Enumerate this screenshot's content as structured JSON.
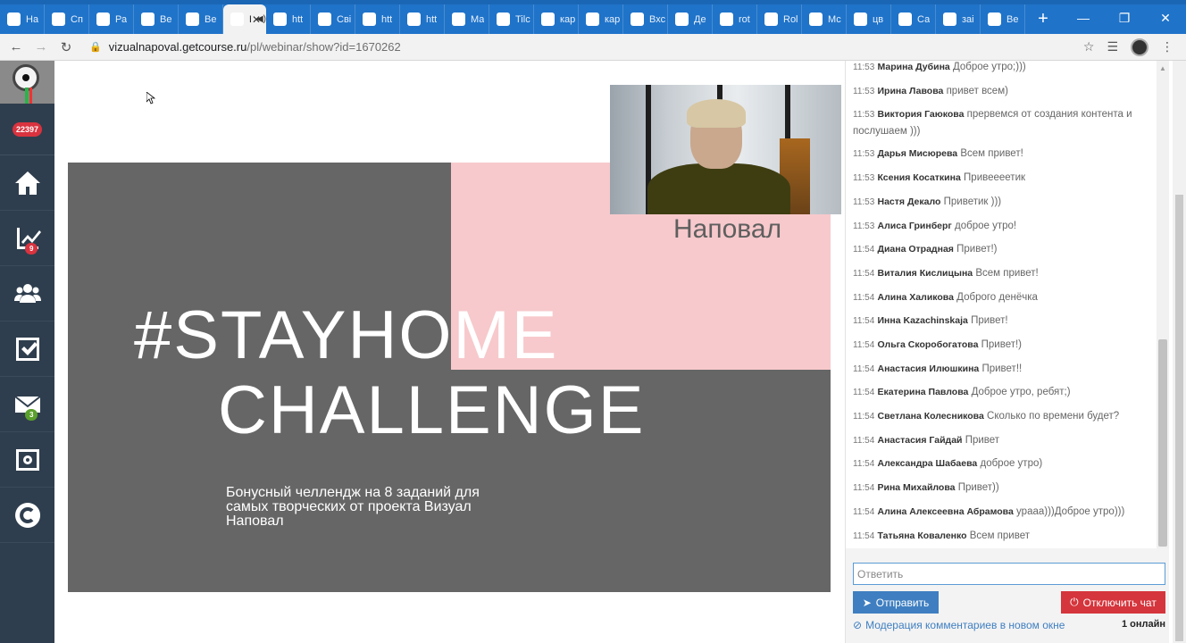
{
  "browser": {
    "tabs": [
      {
        "label": "На",
        "icon": "doc"
      },
      {
        "label": "Сп",
        "icon": "red-dot"
      },
      {
        "label": "Ра",
        "icon": "globe"
      },
      {
        "label": "Ве",
        "icon": "globe"
      },
      {
        "label": "Ве",
        "icon": "globe"
      },
      {
        "label": "В",
        "icon": "active",
        "active": true
      },
      {
        "label": "htt",
        "icon": "swirl"
      },
      {
        "label": "Сві",
        "icon": "bar"
      },
      {
        "label": "htt",
        "icon": "bar"
      },
      {
        "label": "htt",
        "icon": "bar"
      },
      {
        "label": "Ма",
        "icon": "bar"
      },
      {
        "label": "Tilc",
        "icon": "T"
      },
      {
        "label": "кар",
        "icon": "drive"
      },
      {
        "label": "кар",
        "icon": "drive"
      },
      {
        "label": "Вхс",
        "icon": "mail"
      },
      {
        "label": "Де",
        "icon": "arc"
      },
      {
        "label": "rot",
        "icon": "Я"
      },
      {
        "label": "Rol",
        "icon": "F"
      },
      {
        "label": "Мс",
        "icon": "drive"
      },
      {
        "label": "цв",
        "icon": "Я"
      },
      {
        "label": "Са",
        "icon": "pink"
      },
      {
        "label": "заі",
        "icon": "Я"
      },
      {
        "label": "Ве",
        "icon": "GC"
      }
    ],
    "new_tab": "+",
    "url_host": "vizualnapoval.getcourse.ru",
    "url_path": "/pl/webinar/show?id=1670262"
  },
  "sidebar": {
    "counter": "22397",
    "items": [
      {
        "name": "home",
        "badge": ""
      },
      {
        "name": "stats",
        "badge": "9",
        "badge_color": "red"
      },
      {
        "name": "users",
        "badge": ""
      },
      {
        "name": "tasks",
        "badge": ""
      },
      {
        "name": "messages",
        "badge": "3",
        "badge_color": "green"
      },
      {
        "name": "safe",
        "badge": ""
      },
      {
        "name": "getcourse",
        "badge": ""
      }
    ]
  },
  "slide": {
    "brand": "Наповал",
    "line1": "#STAYHOME",
    "line2": "CHALLENGE",
    "subtitle": "Бонусный челлендж на 8 заданий  для самых творческих от проекта Визуал Наповал"
  },
  "chat": {
    "messages": [
      {
        "time": "11:53",
        "name": "Марина Дубина",
        "text": "Доброе утро;)))"
      },
      {
        "time": "11:53",
        "name": "Ирина Лавова",
        "text": "привет всем)"
      },
      {
        "time": "11:53",
        "name": "Виктория Гаюкова",
        "text": "прервемся от создания контента и послушаем )))"
      },
      {
        "time": "11:53",
        "name": "Дарья Мисюрева",
        "text": "Всем привет!"
      },
      {
        "time": "11:53",
        "name": "Ксения Косаткина",
        "text": "Привееeетик"
      },
      {
        "time": "11:53",
        "name": "Настя Декало",
        "text": "Приветик )))"
      },
      {
        "time": "11:53",
        "name": "Алиса Гринберг",
        "text": "доброе утро!"
      },
      {
        "time": "11:54",
        "name": "Диана Отрадная",
        "text": "Привет!)"
      },
      {
        "time": "11:54",
        "name": "Виталия Кислицына",
        "text": "Всем привет!"
      },
      {
        "time": "11:54",
        "name": "Алина Халикова",
        "text": "Доброго денёчка"
      },
      {
        "time": "11:54",
        "name": "Инна Kazachinskaja",
        "text": "Привет!"
      },
      {
        "time": "11:54",
        "name": "Ольга Скоробогатова",
        "text": "Привет!)"
      },
      {
        "time": "11:54",
        "name": "Анастасия Илюшкина",
        "text": "Привет!!"
      },
      {
        "time": "11:54",
        "name": "Екатерина Павлова",
        "text": "Доброе утро, ребят;)"
      },
      {
        "time": "11:54",
        "name": "Светлана Колесникова",
        "text": "Сколько по времени будет?"
      },
      {
        "time": "11:54",
        "name": "Анастасия Гайдай",
        "text": "Привет"
      },
      {
        "time": "11:54",
        "name": "Александра Шабаева",
        "text": "доброе утро)"
      },
      {
        "time": "11:54",
        "name": "Рина Михайлова",
        "text": "Привет))"
      },
      {
        "time": "11:54",
        "name": "Алина Алексеевна Абрамова",
        "text": "урааа)))Доброе утро)))"
      },
      {
        "time": "11:54",
        "name": "Татьяна Коваленко",
        "text": "Всем привет"
      }
    ],
    "reply_placeholder": "Ответить",
    "send_label": "Отправить",
    "disable_label": "Отключить чат",
    "moderation_label": "Модерация комментариев в новом окне",
    "online": "1 онлайн"
  }
}
